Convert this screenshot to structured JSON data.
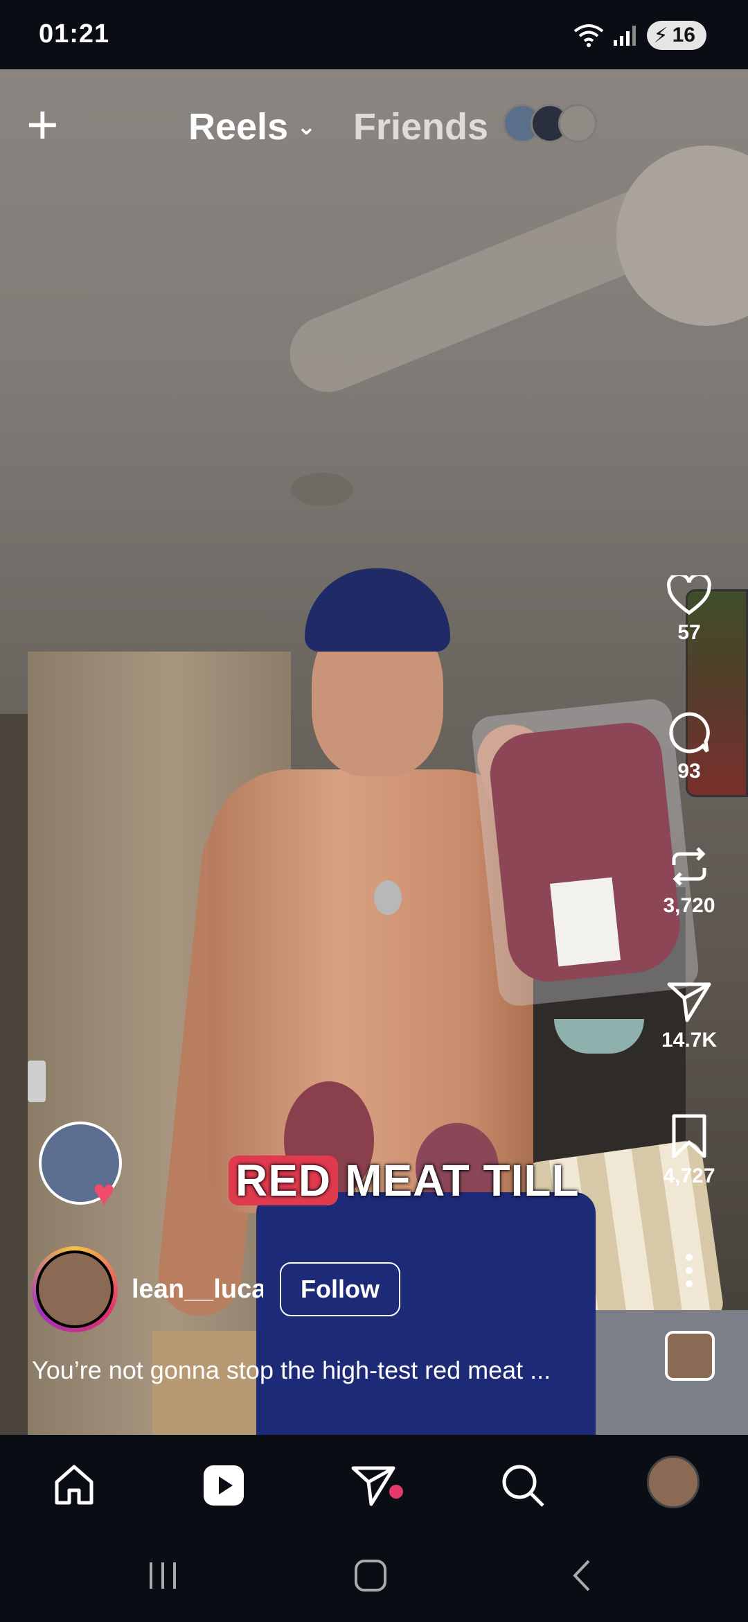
{
  "status_bar": {
    "time": "01:21",
    "battery": "16"
  },
  "top_nav": {
    "create_icon": "plus-icon",
    "reels_label": "Reels",
    "friends_label": "Friends"
  },
  "actions": {
    "likes": "57",
    "comments": "93",
    "reposts": "3,720",
    "shares": "14.7K",
    "saves": "4,727"
  },
  "video_overlay_text": {
    "highlight": "RED",
    "rest": "MEAT TILL"
  },
  "author": {
    "username": "lean__luca",
    "follow_label": "Follow"
  },
  "caption": "You’re not gonna stop the high-test red meat ...",
  "bottom_nav": {
    "items": [
      "home-icon",
      "reels-icon",
      "direct-messages-icon",
      "search-icon",
      "profile-avatar"
    ]
  },
  "colors": {
    "background": "#0b0d14",
    "accent": "#e03a4e",
    "notification_dot": "#e5396a"
  }
}
